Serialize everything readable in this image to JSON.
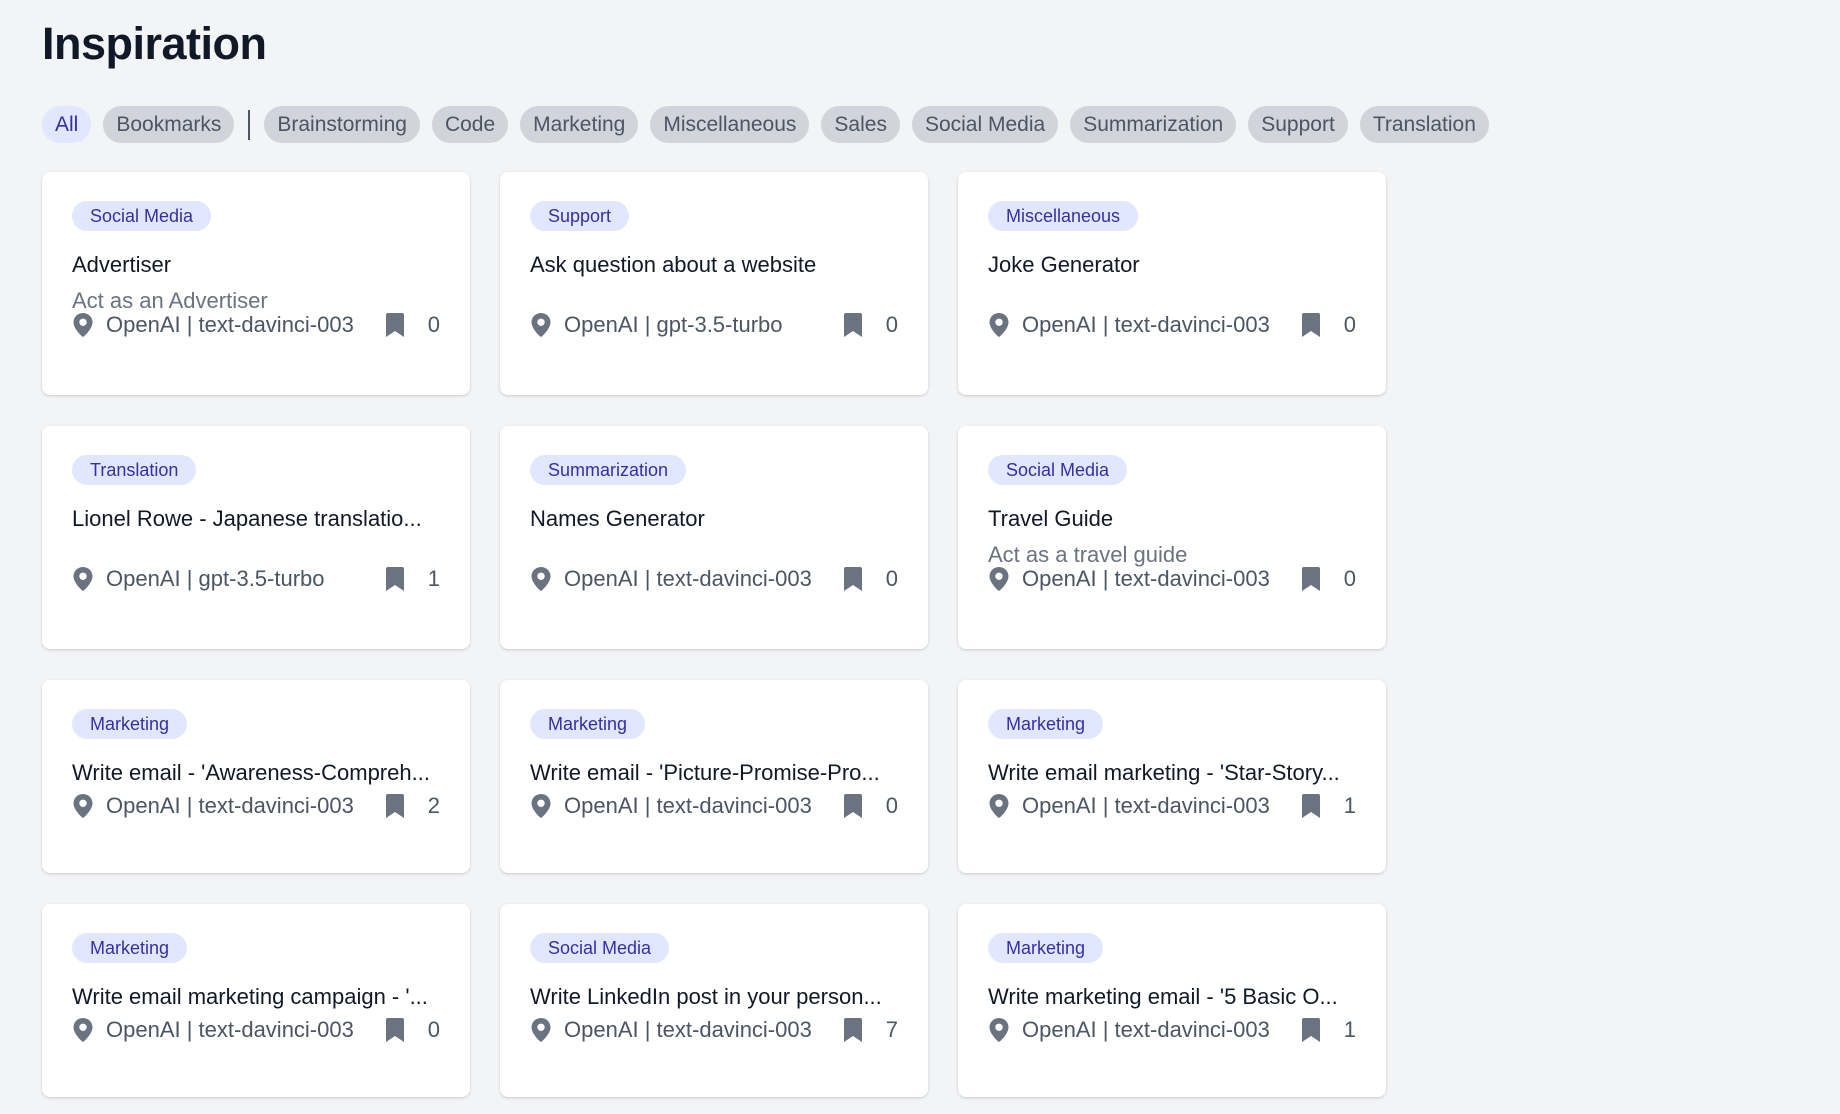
{
  "page": {
    "title": "Inspiration"
  },
  "filters": {
    "all": "All",
    "bookmarks": "Bookmarks",
    "categories": [
      "Brainstorming",
      "Code",
      "Marketing",
      "Miscellaneous",
      "Sales",
      "Social Media",
      "Summarization",
      "Support",
      "Translation"
    ]
  },
  "colors": {
    "background": "#f3f4f6",
    "chip_bg": "#d1d5db",
    "active_chip_bg": "#e0e7ff",
    "tag_text": "#3730a3",
    "icon": "#6b7280"
  },
  "cards": [
    {
      "tag": "Social Media",
      "title": "Advertiser",
      "description": "Act as an Advertiser",
      "model": "OpenAI | text-davinci-003",
      "bookmarks": "0",
      "icon_model": "map-pin-icon",
      "icon_bookmark": "bookmark-icon"
    },
    {
      "tag": "Support",
      "title": "Ask question about a website",
      "description": "",
      "model": "OpenAI | gpt-3.5-turbo",
      "bookmarks": "0",
      "icon_model": "map-pin-icon",
      "icon_bookmark": "bookmark-icon"
    },
    {
      "tag": "Miscellaneous",
      "title": "Joke Generator",
      "description": "",
      "model": "OpenAI | text-davinci-003",
      "bookmarks": "0",
      "icon_model": "map-pin-icon",
      "icon_bookmark": "bookmark-icon"
    },
    {
      "tag": "Translation",
      "title": "Lionel Rowe - Japanese translatio...",
      "description": "",
      "model": "OpenAI | gpt-3.5-turbo",
      "bookmarks": "1",
      "icon_model": "map-pin-icon",
      "icon_bookmark": "bookmark-icon"
    },
    {
      "tag": "Summarization",
      "title": "Names Generator",
      "description": "",
      "model": "OpenAI | text-davinci-003",
      "bookmarks": "0",
      "icon_model": "map-pin-icon",
      "icon_bookmark": "bookmark-icon"
    },
    {
      "tag": "Social Media",
      "title": "Travel Guide",
      "description": "Act as a travel guide",
      "model": "OpenAI | text-davinci-003",
      "bookmarks": "0",
      "icon_model": "map-pin-icon",
      "icon_bookmark": "bookmark-icon"
    },
    {
      "tag": "Marketing",
      "title": "Write email - 'Awareness-Compreh...",
      "description": "",
      "model": "OpenAI | text-davinci-003",
      "bookmarks": "2",
      "icon_model": "map-pin-icon",
      "icon_bookmark": "bookmark-icon"
    },
    {
      "tag": "Marketing",
      "title": "Write email - 'Picture-Promise-Pro...",
      "description": "",
      "model": "OpenAI | text-davinci-003",
      "bookmarks": "0",
      "icon_model": "map-pin-icon",
      "icon_bookmark": "bookmark-icon"
    },
    {
      "tag": "Marketing",
      "title": "Write email marketing - 'Star-Story...",
      "description": "",
      "model": "OpenAI | text-davinci-003",
      "bookmarks": "1",
      "icon_model": "map-pin-icon",
      "icon_bookmark": "bookmark-icon"
    },
    {
      "tag": "Marketing",
      "title": "Write email marketing campaign - '...",
      "description": "",
      "model": "OpenAI | text-davinci-003",
      "bookmarks": "0",
      "icon_model": "map-pin-icon",
      "icon_bookmark": "bookmark-icon"
    },
    {
      "tag": "Social Media",
      "title": "Write LinkedIn post in your person...",
      "description": "",
      "model": "OpenAI | text-davinci-003",
      "bookmarks": "7",
      "icon_model": "map-pin-icon",
      "icon_bookmark": "bookmark-icon"
    },
    {
      "tag": "Marketing",
      "title": "Write marketing email - '5 Basic O...",
      "description": "",
      "model": "OpenAI | text-davinci-003",
      "bookmarks": "1",
      "icon_model": "map-pin-icon",
      "icon_bookmark": "bookmark-icon"
    }
  ]
}
